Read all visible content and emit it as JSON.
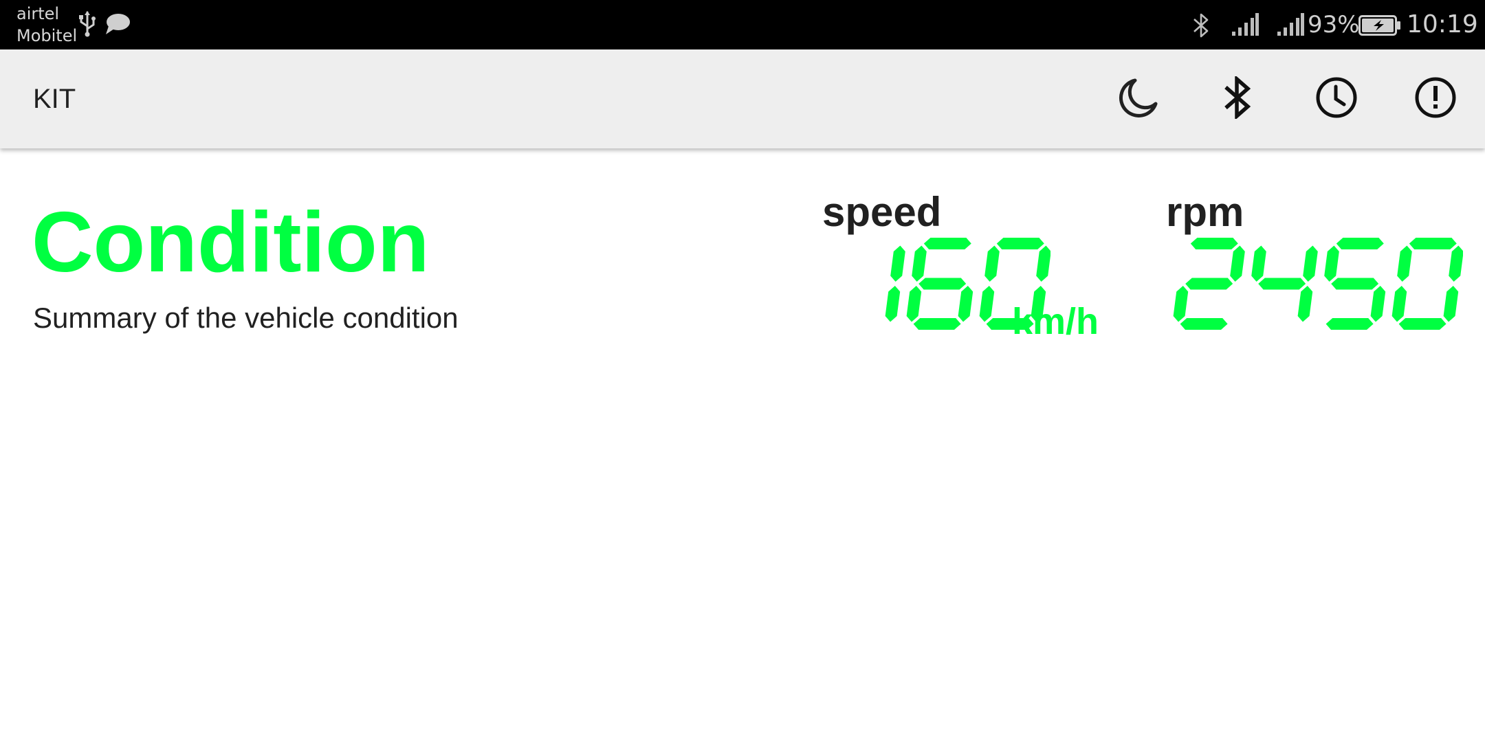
{
  "status_bar": {
    "carrier_1": "airtel",
    "carrier_2": "Mobitel",
    "battery_percent": "93%",
    "time": "10:19",
    "icons": [
      "usb-icon",
      "message-icon",
      "bluetooth-icon",
      "signal-icon",
      "signal-icon",
      "battery-charging-icon"
    ]
  },
  "app_bar": {
    "title": "KIT",
    "actions": [
      {
        "name": "night-mode-button",
        "icon": "moon-icon"
      },
      {
        "name": "bluetooth-button",
        "icon": "bluetooth-icon"
      },
      {
        "name": "history-button",
        "icon": "clock-icon"
      },
      {
        "name": "about-button",
        "icon": "alert-circle-icon"
      }
    ]
  },
  "main": {
    "title": "Condition",
    "subtitle": "Summary of the vehicle condition",
    "speed": {
      "label": "speed",
      "value": "160",
      "unit": "km/h"
    },
    "rpm": {
      "label": "rpm",
      "value": "2450"
    }
  },
  "colors": {
    "accent": "#00ff41",
    "text": "#212121",
    "app_bar": "#eeeeee",
    "status_bar": "#000000"
  }
}
